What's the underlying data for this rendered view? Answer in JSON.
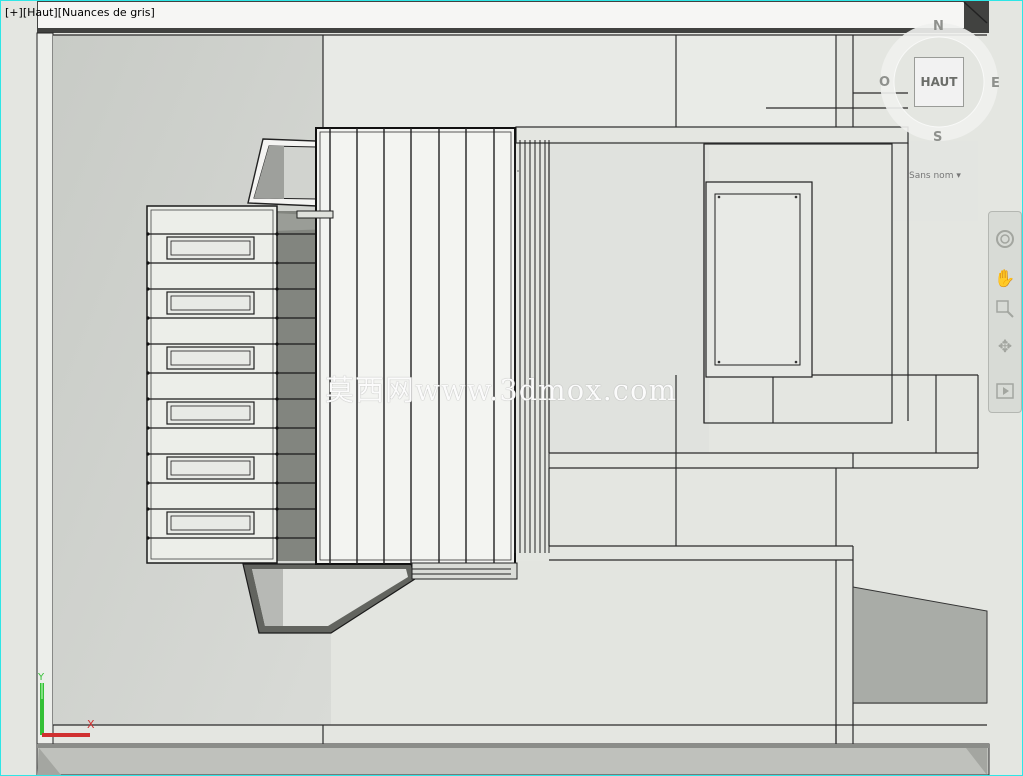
{
  "viewport": {
    "label_plus": "[+]",
    "label_view": "[Haut]",
    "label_shading": "[Nuances de gris]"
  },
  "viewcube": {
    "face_label": "HAUT",
    "north": "N",
    "south": "S",
    "east": "E",
    "west": "O",
    "wcs_menu": "Sans nom"
  },
  "nav_bar": {
    "tools": [
      "full-navigation-wheel-icon",
      "pan-icon",
      "zoom-window-icon",
      "orbit-icon",
      "showmotion-icon"
    ]
  },
  "axis": {
    "y": "Y",
    "x": "X"
  },
  "watermark": "莫西网www.3dmox.com",
  "colors": {
    "viewport_border": "#2ee6e6",
    "axis_y": "#34c036",
    "axis_x": "#d03030"
  }
}
